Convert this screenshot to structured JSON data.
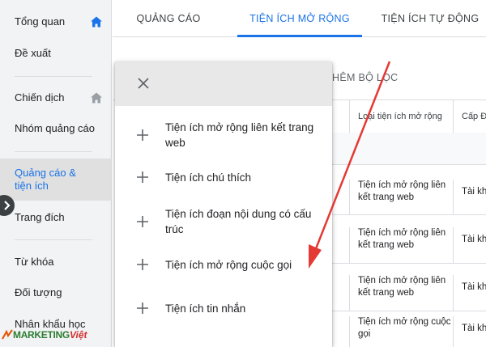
{
  "sidebar": {
    "items": [
      {
        "label": "Tổng quan"
      },
      {
        "label": "Đề xuất"
      },
      {
        "label": "Chiến dịch"
      },
      {
        "label": "Nhóm quảng cáo"
      },
      {
        "label": "Quảng cáo & tiện ích"
      },
      {
        "label": "Trang đích"
      },
      {
        "label": "Từ khóa"
      },
      {
        "label": "Đối tượng"
      },
      {
        "label": "Nhân khẩu học"
      }
    ],
    "active_index": 4,
    "home_icon_color_active": "#1a73e8",
    "home_icon_color": "#9aa0a6"
  },
  "tabs": [
    {
      "label": "QUẢNG CÁO"
    },
    {
      "label": "TIỆN ÍCH MỞ RỘNG"
    },
    {
      "label": "TIỆN ÍCH TỰ ĐỘNG"
    }
  ],
  "active_tab": 1,
  "filter": {
    "label": "HÊM BỘ LỌC"
  },
  "table": {
    "headers": [
      "Loại tiện ích mở rộng",
      "Cấp Đ"
    ],
    "rows": [
      [
        "Tiện ích mở rộng liên kết trang web",
        "Tài kho"
      ],
      [
        "Tiện ích mở rộng liên kết trang web",
        "Tài kho"
      ],
      [
        "Tiện ích mở rộng liên kết trang web",
        "Tài kho"
      ],
      [
        "Tiện ích mở rộng cuộc gọi",
        "Tài kho"
      ]
    ]
  },
  "dialog": {
    "options": [
      {
        "label": "Tiện ích mở rộng liên kết trang web"
      },
      {
        "label": "Tiện ích chú thích"
      },
      {
        "label": "Tiện ích đoạn nội dung có cấu trúc"
      },
      {
        "label": "Tiện ích mở rộng cuộc gọi"
      },
      {
        "label": "Tiện ích tin nhắn"
      }
    ]
  },
  "logo": {
    "part_a": "MARKETING",
    "part_b": "Việt"
  },
  "colors": {
    "accent": "#1a73e8",
    "arrow": "#e53935"
  }
}
